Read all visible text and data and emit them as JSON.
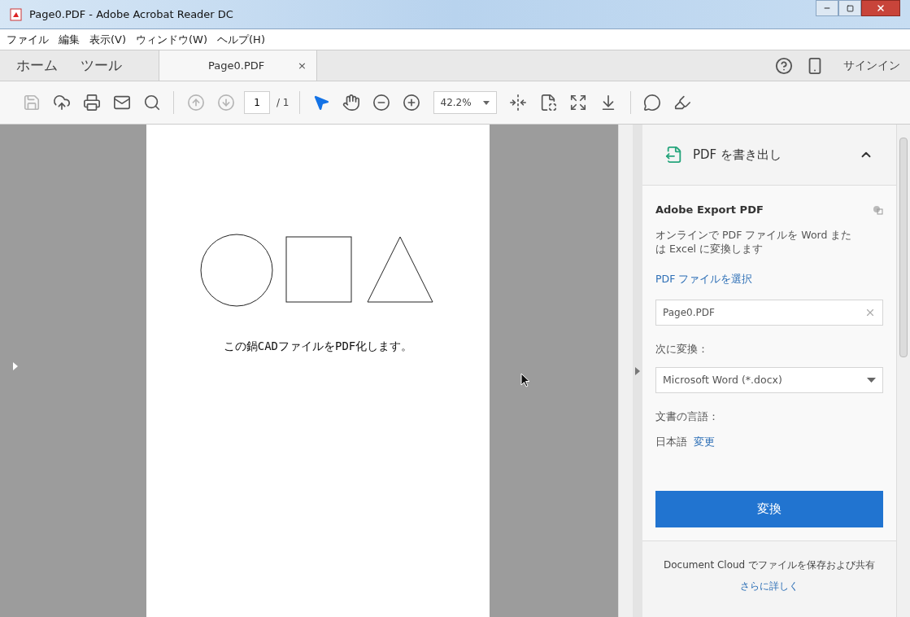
{
  "window": {
    "title": "Page0.PDF - Adobe Acrobat Reader DC"
  },
  "menu": [
    "ファイル",
    "編集",
    "表示(V)",
    "ウィンドウ(W)",
    "ヘルプ(H)"
  ],
  "tabs": [
    {
      "label": "ホーム",
      "kind": "nav",
      "selected": false
    },
    {
      "label": "ツール",
      "kind": "nav",
      "selected": false
    },
    {
      "label": "Page0.PDF",
      "kind": "document",
      "close": "×",
      "selected": true
    }
  ],
  "sign_in": "サインイン",
  "toolbar": [
    {
      "kind": "save",
      "disabled": true,
      "selected": false
    },
    {
      "kind": "upload",
      "disabled": false,
      "selected": false
    },
    {
      "kind": "print",
      "disabled": false,
      "selected": false
    },
    {
      "kind": "mail",
      "disabled": false,
      "selected": false
    },
    {
      "kind": "search",
      "disabled": false,
      "selected": false
    },
    {
      "kind": "separator"
    },
    {
      "kind": "prev",
      "disabled": true,
      "selected": false
    },
    {
      "kind": "next",
      "disabled": true,
      "selected": false
    },
    {
      "kind": "page",
      "value": "1",
      "total": "/ 1"
    },
    {
      "kind": "separator"
    },
    {
      "kind": "pointer",
      "disabled": false,
      "selected": true
    },
    {
      "kind": "hand",
      "disabled": false,
      "selected": false
    },
    {
      "kind": "zoom-out",
      "disabled": false,
      "selected": false
    },
    {
      "kind": "zoom-in",
      "disabled": false,
      "selected": false
    },
    {
      "kind": "zoom",
      "value": "42.2%"
    },
    {
      "kind": "fit-width",
      "disabled": false,
      "selected": false
    },
    {
      "kind": "fit-page",
      "disabled": false,
      "selected": false
    },
    {
      "kind": "full-screen",
      "disabled": false,
      "selected": false
    },
    {
      "kind": "scroll",
      "disabled": false,
      "selected": false
    },
    {
      "kind": "separator"
    },
    {
      "kind": "comment",
      "disabled": false,
      "selected": false
    },
    {
      "kind": "sign",
      "disabled": false,
      "selected": false
    }
  ],
  "document": {
    "caption": "この鍋CADファイルをPDF化します。"
  },
  "panel": {
    "title": "PDF を書き出し",
    "expanded": true,
    "section_title": "Adobe Export PDF",
    "description": "オンラインで PDF ファイルを Word または Excel に変換します",
    "select_link": "PDF ファイルを選択",
    "file_field": "Page0.PDF",
    "convert_to_label": "次に変換：",
    "format": "Microsoft Word (*.docx)",
    "language_label": "文書の言語：",
    "language": "日本語",
    "change_link": "変更",
    "convert_button": "変換",
    "cloud_text": "Document Cloud でファイルを保存および共有",
    "learn_more": "さらに詳しく"
  }
}
